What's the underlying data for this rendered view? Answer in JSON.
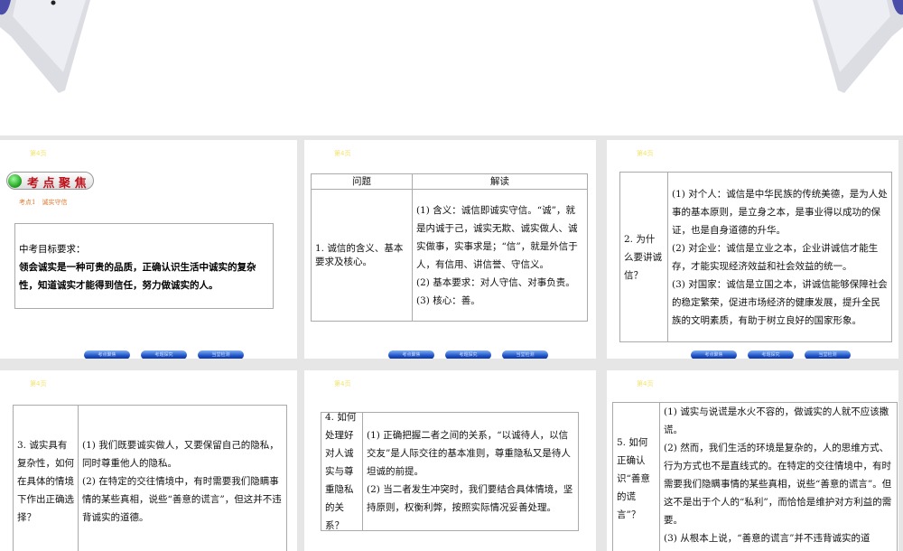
{
  "slide_tag": "第4页",
  "nav_buttons": [
    "考点聚焦",
    "考题探究",
    "当堂检测"
  ],
  "slide1": {
    "banner": "考 点 聚 焦",
    "subtitle": "考点1　诚实守信",
    "box_title": "中考目标要求：",
    "box_text": "领会诚实是一种可贵的品质，正确认识生活中诚实的复杂性，知道诚实才能得到信任，努力做诚实的人。"
  },
  "slide2": {
    "head1": "问题",
    "head2": "解读",
    "question": "1. 诚信的含义、基本要求及核心。",
    "answers": [
      "(1) 含义：诚信即诚实守信。“诚”，就是内诚于己，诚实无欺、诚实做人、诚实做事，实事求是；“信”，就是外信于人，有信用、讲信誉、守信义。",
      "(2) 基本要求：对人守信、对事负责。",
      "(3) 核心：善。"
    ]
  },
  "slide3": {
    "question": "2. 为什么要讲诚信？",
    "answers": [
      "(1) 对个人：诚信是中华民族的传统美德，是为人处事的基本原则，是立身之本，是事业得以成功的保证，也是自身道德的升华。",
      "(2) 对企业：诚信是立业之本，企业讲诚信才能生存，才能实现经济效益和社会效益的统一。",
      "(3) 对国家：诚信是立国之本，讲诚信能够保障社会的稳定繁荣，促进市场经济的健康发展，提升全民族的文明素质，有助于树立良好的国家形象。"
    ]
  },
  "slide4": {
    "question": "3. 诚实具有复杂性，如何在具体的情境下作出正确选择？",
    "answers": [
      "(1) 我们既要诚实做人，又要保留自己的隐私，同时尊重他人的隐私。",
      "(2) 在特定的交往情境中，有时需要我们隐瞒事情的某些真相，说些“善意的谎言”，但这并不违背诚实的道德。"
    ]
  },
  "slide5": {
    "question": "4. 如何处理好对人诚实与尊重隐私的关系？",
    "answers": [
      "(1) 正确把握二者之间的关系，“以诚待人，以信交友”是人际交往的基本准则，尊重隐私又是待人坦诚的前提。",
      "(2) 当二者发生冲突时，我们要结合具体情境，坚持原则，权衡利弊，按照实际情况妥善处理。"
    ]
  },
  "slide6": {
    "question": "5. 如何正确认识“善意的谎言”？",
    "answers": [
      "(1) 诚实与说谎是水火不容的，做诚实的人就不应该撒谎。",
      "(2) 然而，我们生活的环境是复杂的，人的思维方式、行为方式也不是直线式的。在特定的交往情境中，有时需要我们隐瞒事情的某些真相，说些“善意的谎言”。但这不是出于个人的“私利”，而恰恰是维护对方利益的需要。",
      "(3) 从根本上说，“善意的谎言”并不违背诚实的道"
    ]
  }
}
